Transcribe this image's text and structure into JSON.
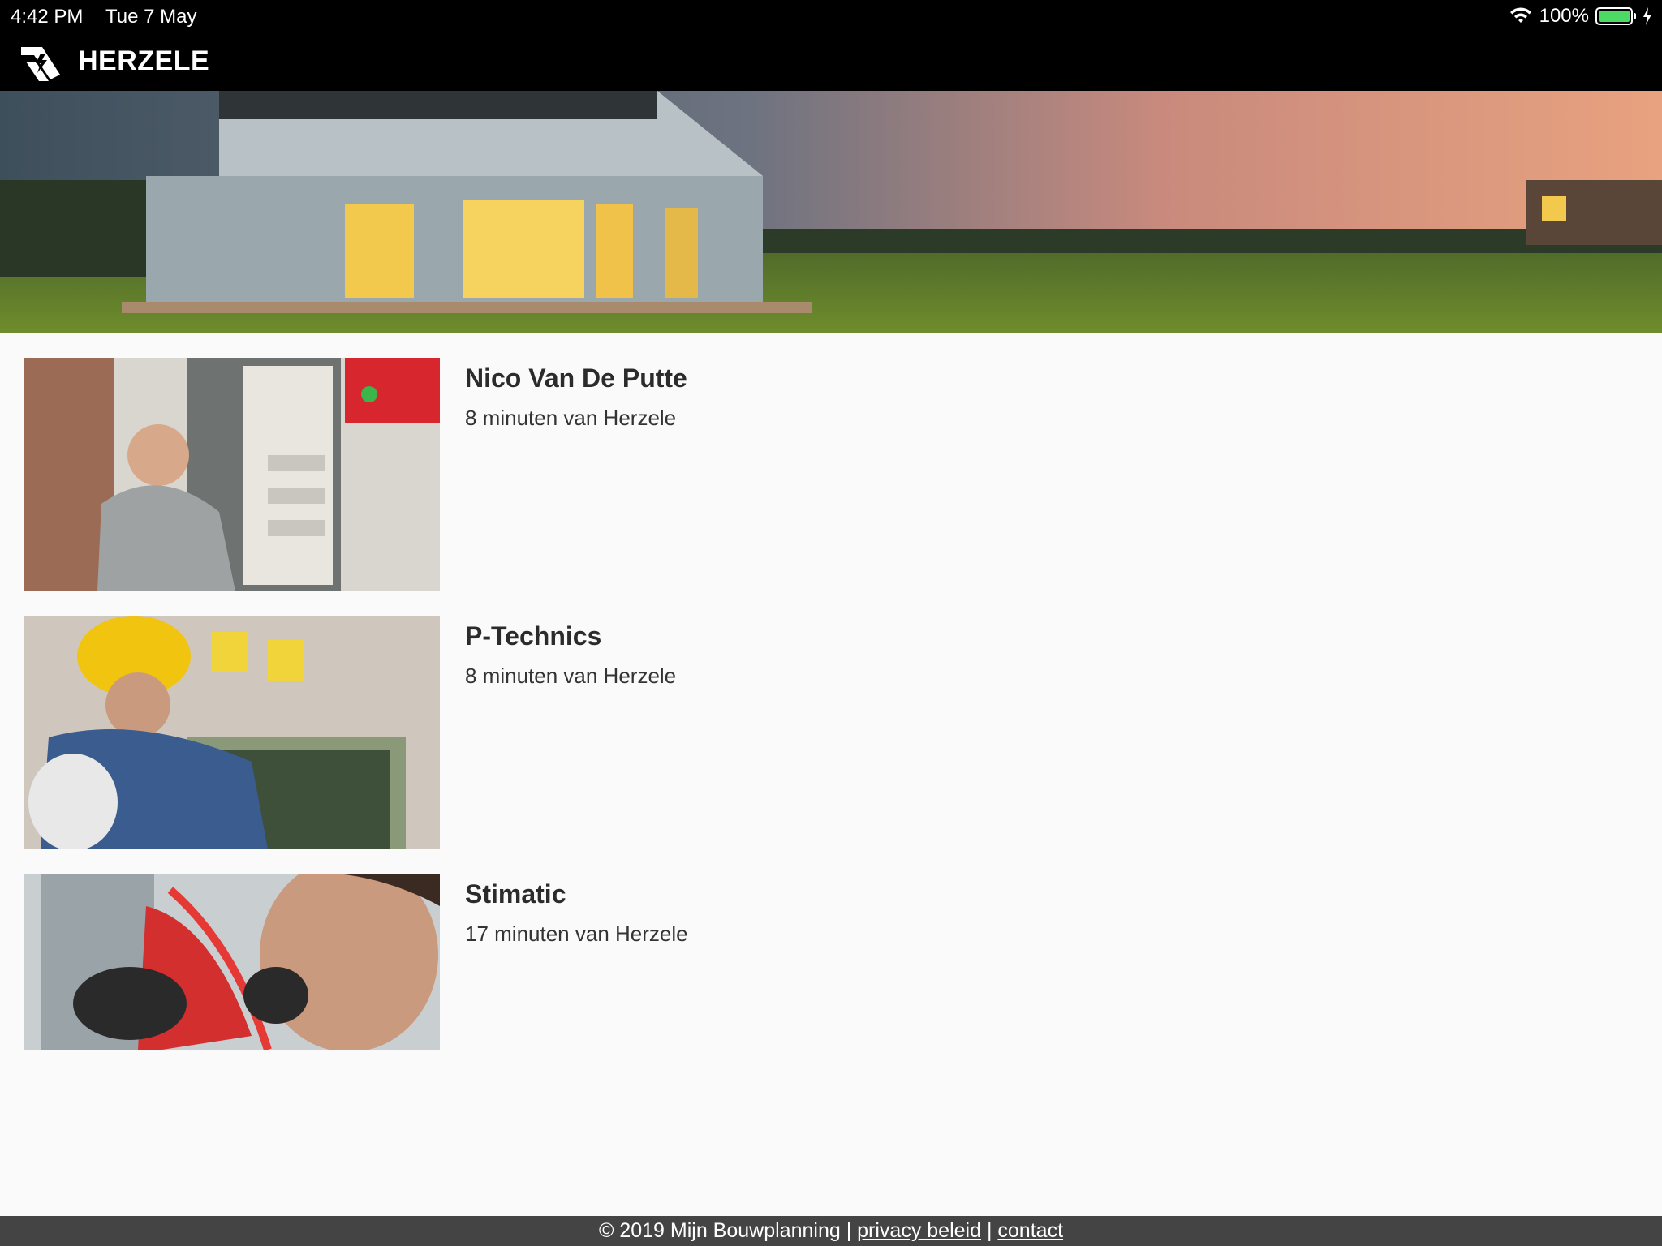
{
  "statusbar": {
    "time": "4:42 PM",
    "date": "Tue 7 May",
    "battery": "100%"
  },
  "navbar": {
    "title": "HERZELE"
  },
  "listings": [
    {
      "name": "Nico Van De Putte",
      "distance": "8 minuten van Herzele"
    },
    {
      "name": "P-Technics",
      "distance": "8 minuten van Herzele"
    },
    {
      "name": "Stimatic",
      "distance": "17 minuten van Herzele"
    }
  ],
  "footer": {
    "copyright": "© 2019 Mijn Bouwplanning |",
    "privacy": "privacy beleid",
    "separator": "|",
    "contact": "contact"
  }
}
